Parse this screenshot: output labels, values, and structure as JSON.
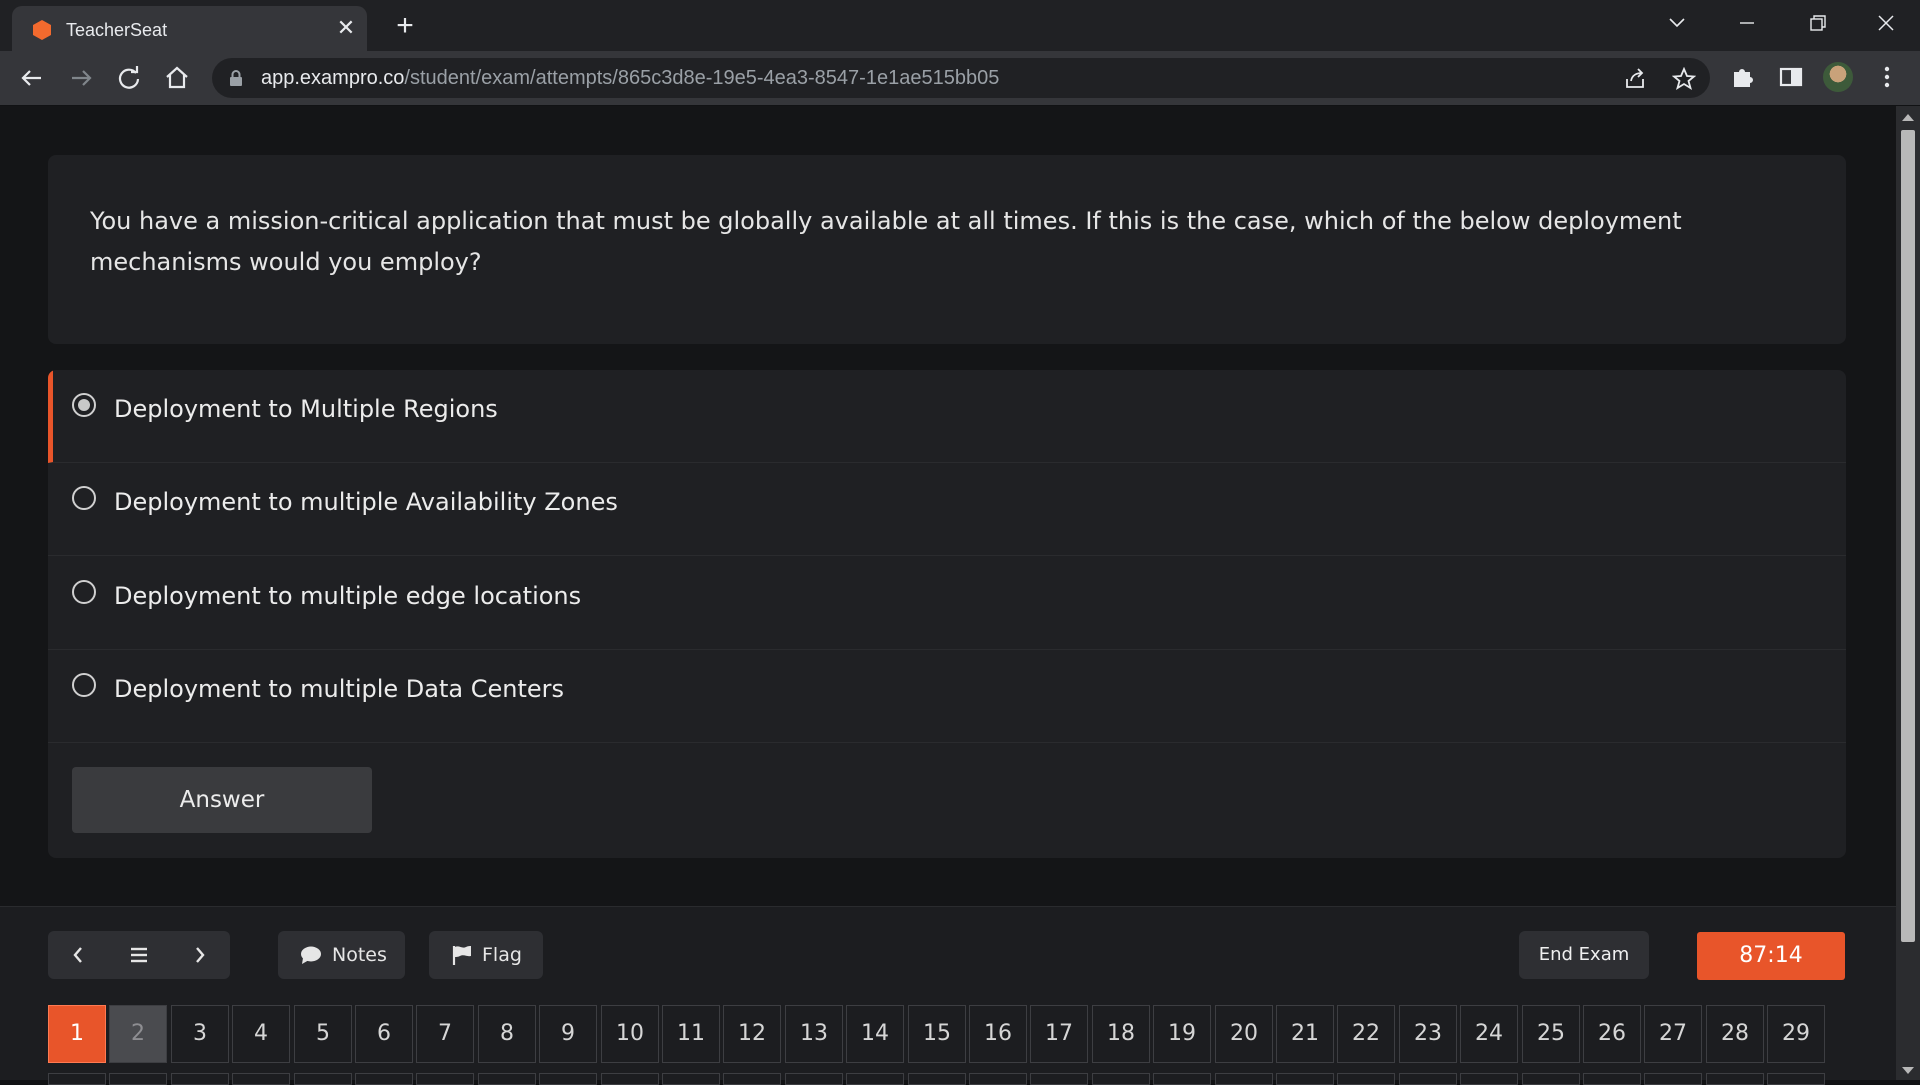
{
  "browser": {
    "tab_title": "TeacherSeat",
    "url_host": "app.exampro.co",
    "url_path": "/student/exam/attempts/865c3d8e-19e5-4ea3-8547-1e1ae515bb05"
  },
  "question": {
    "text": "You have a mission-critical application that must be globally available at all times. If this is the case, which of the below deployment mechanisms would you employ?"
  },
  "options": [
    {
      "label": "Deployment to Multiple Regions",
      "selected": true
    },
    {
      "label": "Deployment to multiple Availability Zones",
      "selected": false
    },
    {
      "label": "Deployment to multiple edge locations",
      "selected": false
    },
    {
      "label": "Deployment to multiple Data Centers",
      "selected": false
    }
  ],
  "answer_button": "Answer",
  "footer": {
    "notes_label": "Notes",
    "flag_label": "Flag",
    "end_exam_label": "End Exam",
    "timer": "87:14"
  },
  "question_numbers": [
    "1",
    "2",
    "3",
    "4",
    "5",
    "6",
    "7",
    "8",
    "9",
    "10",
    "11",
    "12",
    "13",
    "14",
    "15",
    "16",
    "17",
    "18",
    "19",
    "20",
    "21",
    "22",
    "23",
    "24",
    "25",
    "26",
    "27",
    "28",
    "29"
  ],
  "current_question": "1",
  "visited_questions": [
    "2"
  ],
  "colors": {
    "accent": "#e8552a",
    "background": "#141517",
    "card": "#1f2023"
  }
}
